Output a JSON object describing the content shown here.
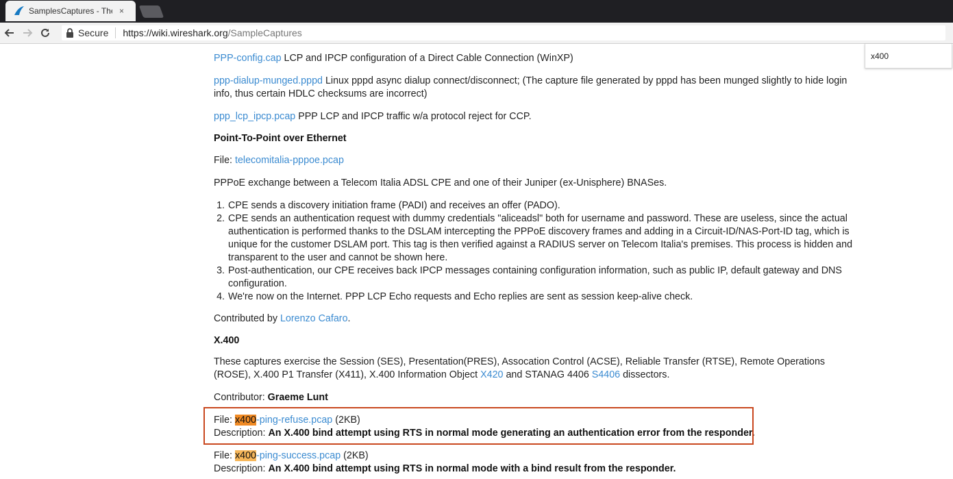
{
  "browser": {
    "tab_title": "SamplesCaptures - The W",
    "tab_close": "×",
    "secure_label": "Secure",
    "url_host": "https://wiki.wireshark.org",
    "url_path": "/SampleCaptures"
  },
  "find": {
    "query": "x400"
  },
  "ppp": [
    {
      "link": "PPP-config.cap",
      "text": " LCP and IPCP configuration of a Direct Cable Connection (WinXP)"
    },
    {
      "link": "ppp-dialup-munged.pppd",
      "text": " Linux pppd async dialup connect/disconnect; (The capture file generated by pppd has been munged slightly to hide login info, thus certain HDLC checksums are incorrect)"
    },
    {
      "link": "ppp_lcp_ipcp.pcap",
      "text": " PPP LCP and IPCP traffic w/a protocol reject for CCP."
    }
  ],
  "pppoe": {
    "heading": "Point-To-Point over Ethernet",
    "file_label": "File: ",
    "file_link": "telecomitalia-pppoe.pcap",
    "description": "PPPoE exchange between a Telecom Italia ADSL CPE and one of their Juniper (ex-Unisphere) BNASes.",
    "steps": [
      "CPE sends a discovery initiation frame (PADI) and receives an offer (PADO).",
      "CPE sends an authentication request with dummy credentials \"aliceadsl\" both for username and password. These are useless, since the actual authentication is performed thanks to the DSLAM intercepting the PPPoE discovery frames and adding in a Circuit-ID/NAS-Port-ID tag, which is unique for the customer DSLAM port. This tag is then verified against a RADIUS server on Telecom Italia's premises. This process is hidden and transparent to the user and cannot be shown here.",
      "Post-authentication, our CPE receives back IPCP messages containing configuration information, such as public IP, default gateway and DNS configuration.",
      "We're now on the Internet. PPP LCP Echo requests and Echo replies are sent as session keep-alive check."
    ],
    "contrib_label": "Contributed by ",
    "contrib_link": "Lorenzo Cafaro",
    "contrib_end": "."
  },
  "x400": {
    "heading": "X.400",
    "desc_pre": "These captures exercise the Session (SES), Presentation(PRES), Assocation Control (ACSE), Reliable Transfer (RTSE), Remote Operations (ROSE), X.400 P1 Transfer (X411), X.400 Information Object ",
    "desc_link1": "X420",
    "desc_mid": " and STANAG 4406 ",
    "desc_link2": "S4406",
    "desc_post": " dissectors.",
    "contributor_label": "Contributor: ",
    "contributor_name": "Graeme Lunt",
    "files": [
      {
        "file_label": "File: ",
        "link_highlight": "x400",
        "link_rest": "-ping-refuse.pcap",
        "size": " (2KB)",
        "desc_label": "Description: ",
        "desc": "An X.400 bind attempt using RTS in normal mode generating an authentication error from the responder."
      },
      {
        "file_label": "File: ",
        "link_highlight": "x400",
        "link_rest": "-ping-success.pcap",
        "size": " (2KB)",
        "desc_label": "Description: ",
        "desc": "An X.400 bind attempt using RTS in normal mode with a bind result from the responder."
      }
    ]
  }
}
